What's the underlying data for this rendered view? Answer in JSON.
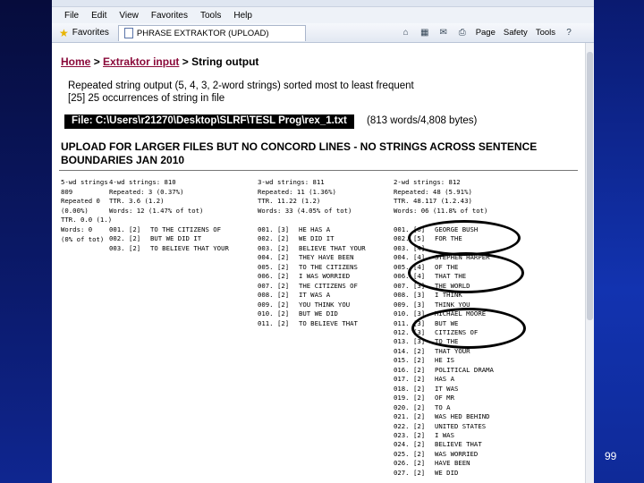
{
  "browser": {
    "menu": [
      "File",
      "Edit",
      "View",
      "Favorites",
      "Tools",
      "Help"
    ],
    "favorites_label": "Favorites",
    "tab_title": "PHRASE EXTRAKTOR (UPLOAD)",
    "toolbar_items": [
      "Page",
      "Safety",
      "Tools"
    ]
  },
  "breadcrumb": {
    "home": "Home",
    "sep1": ">",
    "extraktor": "Extraktor input",
    "sep2": ">",
    "current": "String output"
  },
  "description": {
    "line1": "Repeated string output (5, 4, 3, 2-word strings) sorted most to least frequent",
    "line2": "[25]    25 occurrences of string in file"
  },
  "file": {
    "label": "File: C:\\Users\\r21270\\Desktop\\SLRF\\TESL Prog\\rex_1.txt",
    "info": "(813 words/4,808 bytes)"
  },
  "upload_notice": "UPLOAD FOR LARGER FILES BUT NO CONCORD LINES - NO STRINGS ACROSS SENTENCE BOUNDARIES JAN 2010",
  "columns": {
    "five_word": {
      "stats": [
        "5-wd strings",
        "809",
        "Repeated 0",
        "(0.00%)",
        "TTR. 0.0 (1.)",
        "Words: 0",
        "(0% of tot)"
      ]
    },
    "four_word": {
      "stats": [
        "4-wd strings: 810",
        "Repeated: 3 (0.37%)",
        "TTR. 3.6 (1.2)",
        "Words: 12 (1.47% of tot)"
      ],
      "rows": [
        {
          "n": "001.",
          "c": "[2]",
          "s": "TO THE CITIZENS OF"
        },
        {
          "n": "002.",
          "c": "[2]",
          "s": "BUT WE DID IT"
        },
        {
          "n": "003.",
          "c": "[2]",
          "s": "TO BELIEVE THAT YOUR"
        }
      ]
    },
    "three_word": {
      "stats": [
        "3-wd strings: 811",
        "Repeated: 11 (1.36%)",
        "TTR. 11.22 (1.2)",
        "Words: 33 (4.05% of tot)"
      ],
      "rows": [
        {
          "n": "001.",
          "c": "[3]",
          "s": "HE HAS A"
        },
        {
          "n": "002.",
          "c": "[2]",
          "s": "WE DID IT"
        },
        {
          "n": "003.",
          "c": "[2]",
          "s": "BELIEVE THAT YOUR"
        },
        {
          "n": "004.",
          "c": "[2]",
          "s": "THEY HAVE BEEN"
        },
        {
          "n": "005.",
          "c": "[2]",
          "s": "TO THE CITIZENS"
        },
        {
          "n": "006.",
          "c": "[2]",
          "s": "I WAS WORRIED"
        },
        {
          "n": "007.",
          "c": "[2]",
          "s": "THE CITIZENS OF"
        },
        {
          "n": "008.",
          "c": "[2]",
          "s": "IT WAS A"
        },
        {
          "n": "009.",
          "c": "[2]",
          "s": "YOU THINK YOU"
        },
        {
          "n": "010.",
          "c": "[2]",
          "s": "BUT WE DID"
        },
        {
          "n": "011.",
          "c": "[2]",
          "s": "TO BELIEVE THAT"
        }
      ]
    },
    "two_word": {
      "stats": [
        "2-wd strings: 812",
        "Repeated: 48 (5.91%)",
        "TTR. 48.117 (1.2.43)",
        "Words: 06 (11.8% of tot)"
      ],
      "rows": [
        {
          "n": "001.",
          "c": "[6]",
          "s": "GEORGE BUSH"
        },
        {
          "n": "002.",
          "c": "[5]",
          "s": "FOR THE"
        },
        {
          "n": "003.",
          "c": "[4]",
          "s": ""
        },
        {
          "n": "004.",
          "c": "[4]",
          "s": "STEPHEN HARPER"
        },
        {
          "n": "005.",
          "c": "[4]",
          "s": "OF THE"
        },
        {
          "n": "006.",
          "c": "[4]",
          "s": "THAT THE"
        },
        {
          "n": "007.",
          "c": "[3]",
          "s": "THE WORLD"
        },
        {
          "n": "008.",
          "c": "[3]",
          "s": "I THINK"
        },
        {
          "n": "009.",
          "c": "[3]",
          "s": "THINK YOU"
        },
        {
          "n": "010.",
          "c": "[3]",
          "s": "MICHAEL MOORE"
        },
        {
          "n": "011.",
          "c": "[3]",
          "s": "BUT WE"
        },
        {
          "n": "012.",
          "c": "[3]",
          "s": "CITIZENS OF"
        },
        {
          "n": "013.",
          "c": "[3]",
          "s": "TO THE"
        },
        {
          "n": "014.",
          "c": "[2]",
          "s": "THAT YOUR"
        },
        {
          "n": "015.",
          "c": "[2]",
          "s": "HE IS"
        },
        {
          "n": "016.",
          "c": "[2]",
          "s": "POLITICAL DRAMA"
        },
        {
          "n": "017.",
          "c": "[2]",
          "s": "HAS A"
        },
        {
          "n": "018.",
          "c": "[2]",
          "s": "IT WAS"
        },
        {
          "n": "019.",
          "c": "[2]",
          "s": "OF MR"
        },
        {
          "n": "020.",
          "c": "[2]",
          "s": "TO A"
        },
        {
          "n": "021.",
          "c": "[2]",
          "s": "WAS HED BEHIND"
        },
        {
          "n": "022.",
          "c": "[2]",
          "s": "UNITED STATES"
        },
        {
          "n": "023.",
          "c": "[2]",
          "s": "I WAS"
        },
        {
          "n": "024.",
          "c": "[2]",
          "s": "BELIEVE THAT"
        },
        {
          "n": "025.",
          "c": "[2]",
          "s": "WAS WORRIED"
        },
        {
          "n": "026.",
          "c": "[2]",
          "s": "HAVE BEEN"
        },
        {
          "n": "027.",
          "c": "[2]",
          "s": "WE DID"
        }
      ]
    }
  },
  "slide_number": "99",
  "colors": {
    "breadcrumb_link": "#8a0a3a",
    "slide_bg": "#0a1a72"
  }
}
